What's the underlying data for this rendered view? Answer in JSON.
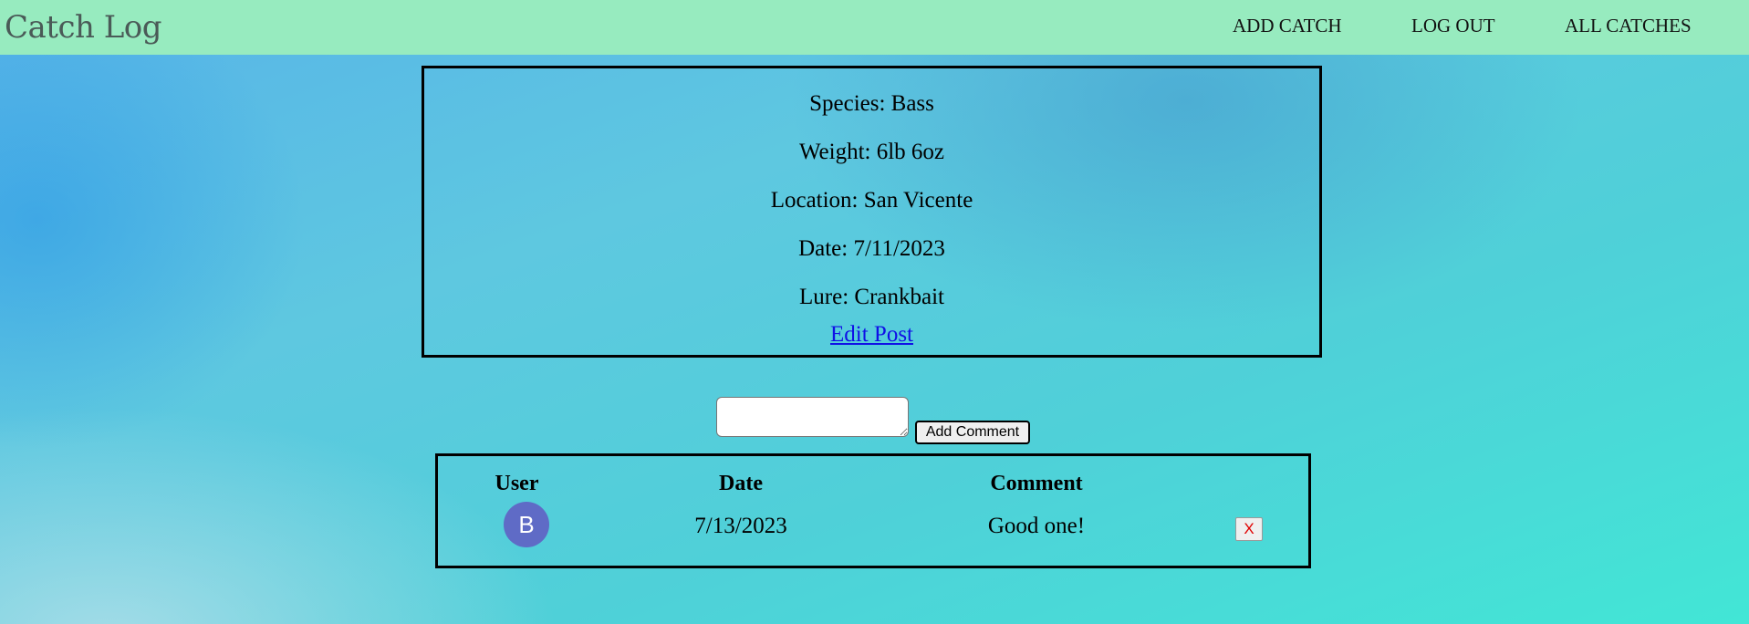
{
  "app": {
    "title": "Catch Log"
  },
  "nav": {
    "add_catch": "ADD CATCH",
    "log_out": "LOG OUT",
    "all_catches": "ALL CATCHES"
  },
  "catch": {
    "species": "Species: Bass",
    "weight": "Weight: 6lb 6oz",
    "location": "Location: San Vicente",
    "date": "Date: 7/11/2023",
    "lure": "Lure: Crankbait",
    "edit_link": "Edit Post"
  },
  "comment_form": {
    "value": "",
    "placeholder": "",
    "submit_label": "Add Comment"
  },
  "comments": {
    "headers": {
      "user": "User",
      "date": "Date",
      "comment": "Comment"
    },
    "rows": [
      {
        "avatar_initial": "B",
        "date": "7/13/2023",
        "comment": "Good one!",
        "delete_label": "X"
      }
    ]
  },
  "colors": {
    "navbar": "#97ebbf",
    "avatar": "#5f6bc6",
    "link": "#1010e6",
    "delete": "#e00000"
  }
}
